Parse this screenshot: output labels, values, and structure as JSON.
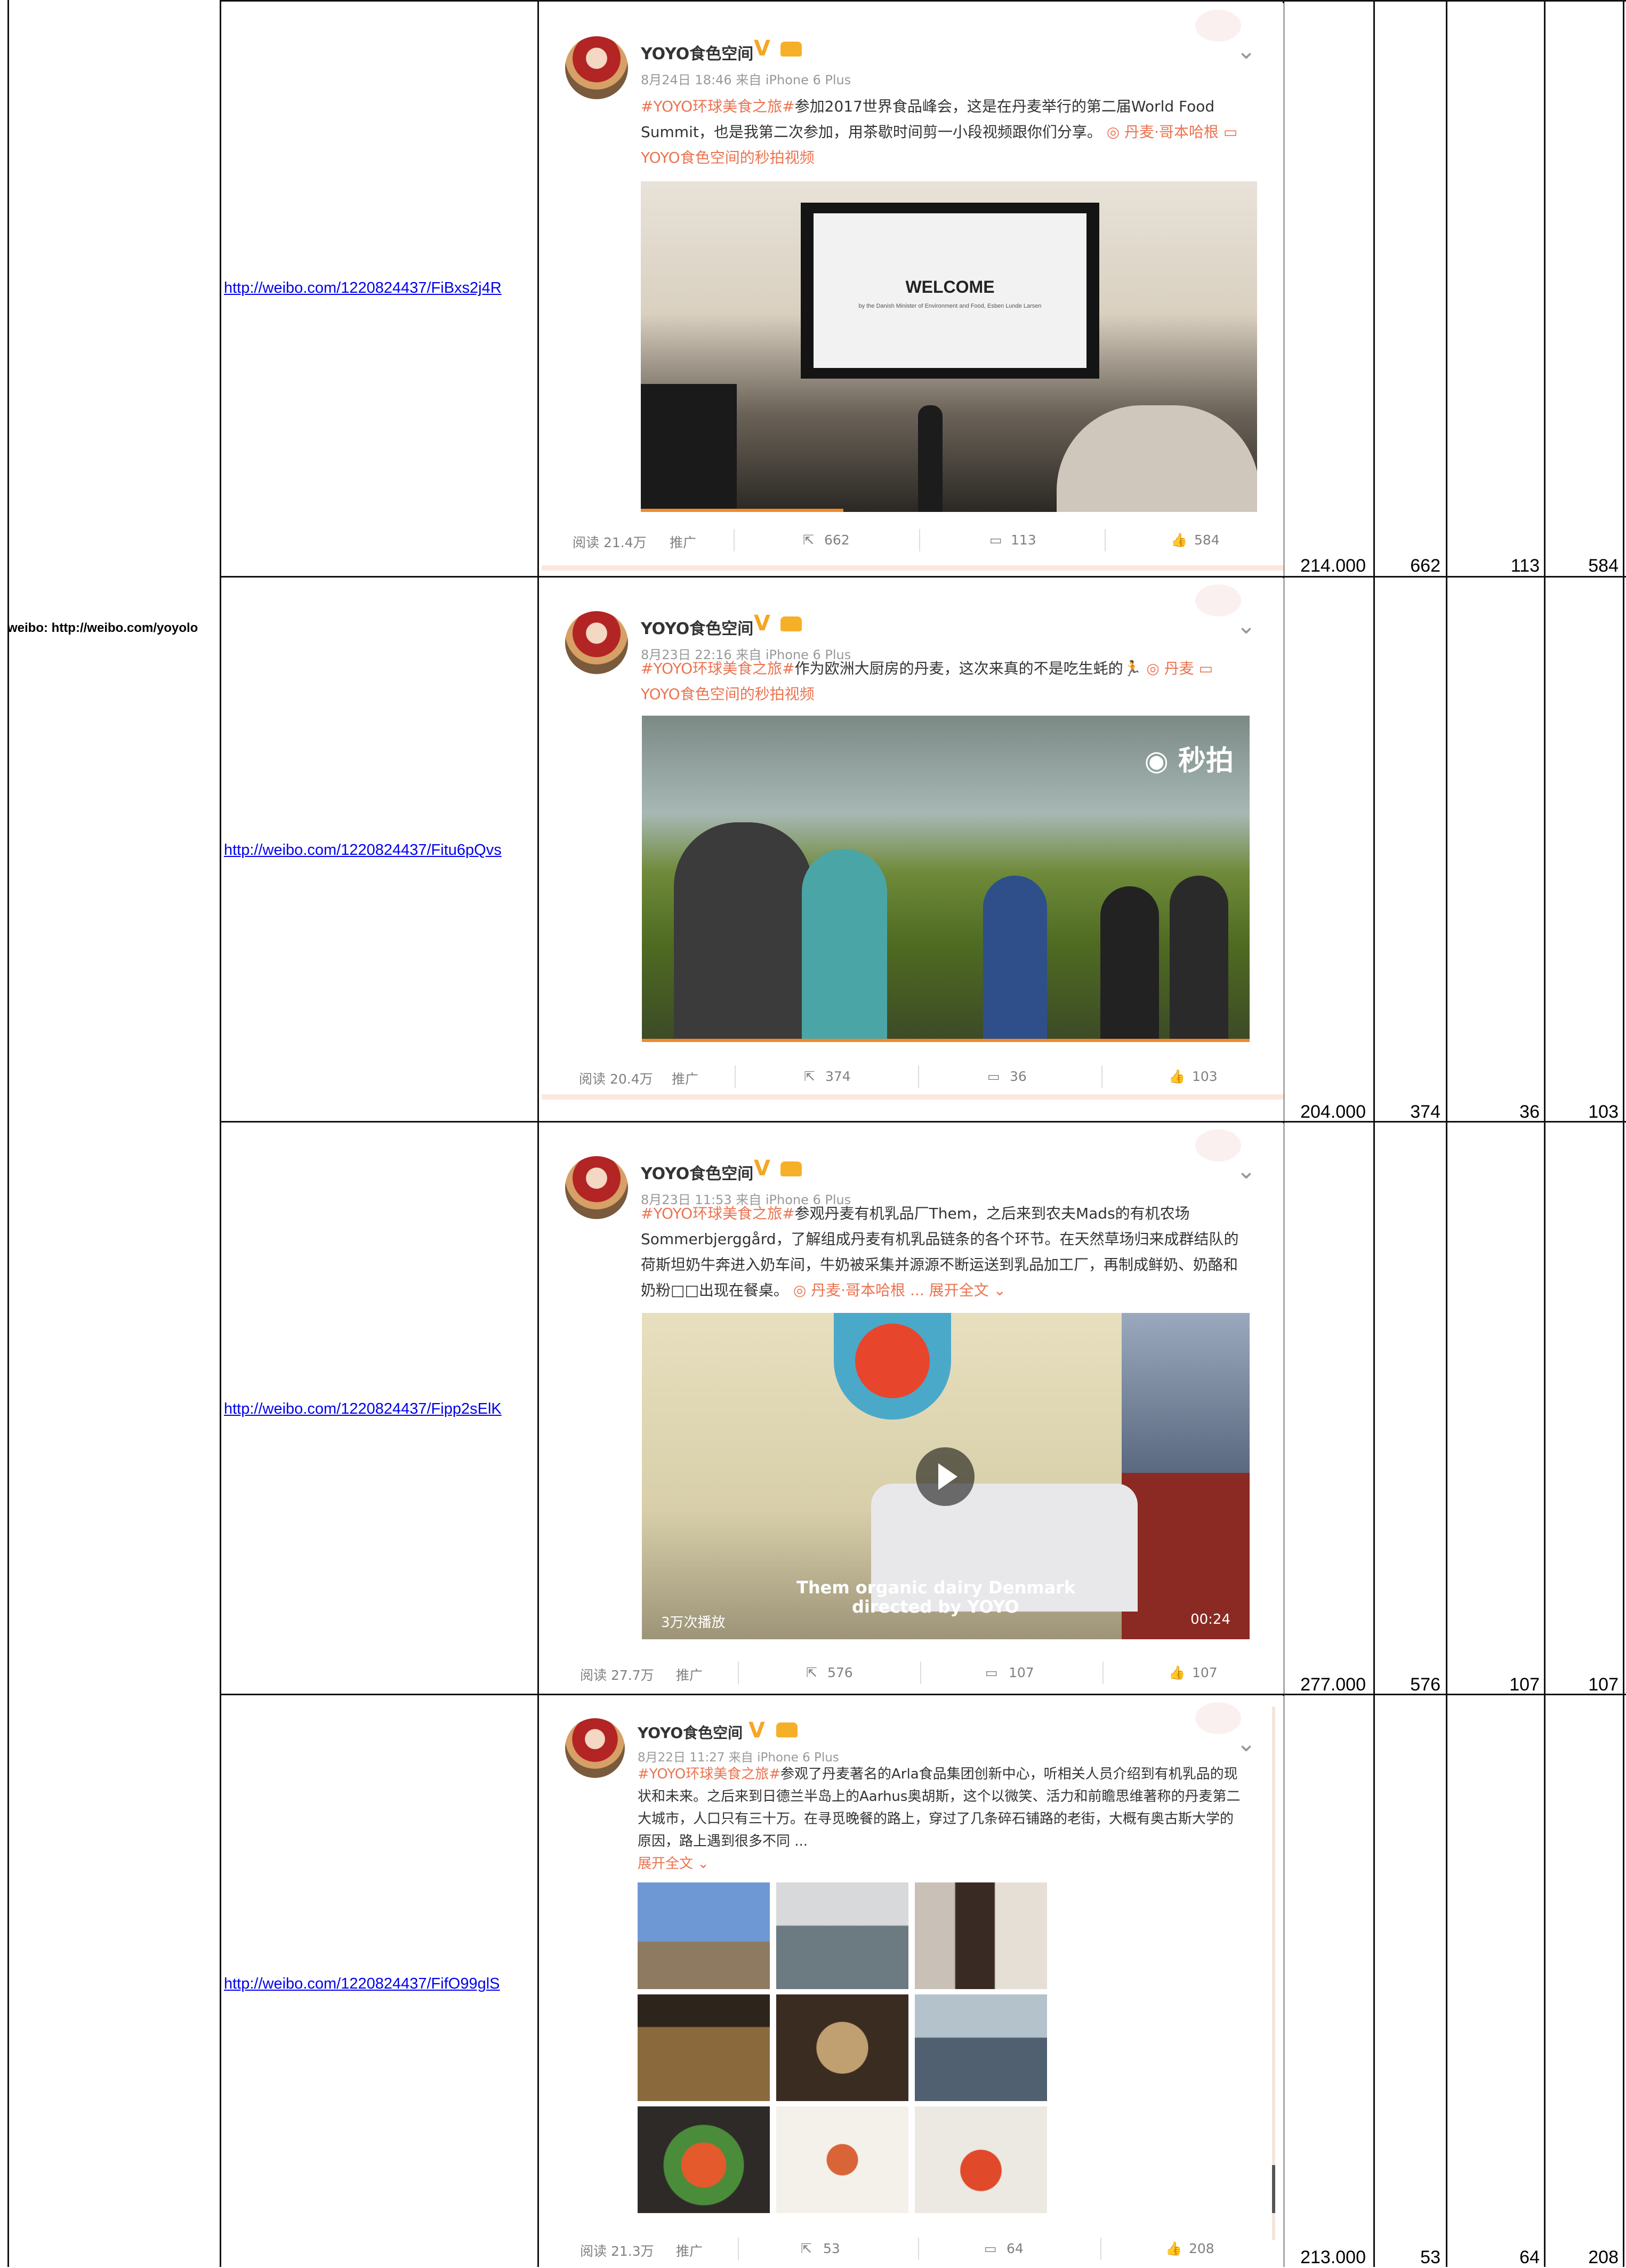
{
  "account": "weibo: http://weibo.com/yoyolo",
  "rows": [
    {
      "url": "http://weibo.com/1220824437/FiBxs2j4R",
      "reads": "214.000",
      "shares": "662",
      "comments": "113",
      "likes": "584",
      "post": {
        "username": "YOYO食色空间",
        "meta": "8月24日 18:46 来自 iPhone 6 Plus",
        "hashtag": "#YOYO环球美食之旅#",
        "text": "参加2017世界食品峰会，这是在丹麦举行的第二届World Food Summit，也是我第二次参加，用茶歇时间剪一小段视频跟你们分享。",
        "location": "丹麦·哥本哈根",
        "video_label": "YOYO食色空间的秒拍视频",
        "screen_title": "WELCOME",
        "screen_sub": "by the Danish Minister of Environment and Food, Esben Lunde Larsen",
        "stats": {
          "read": "阅读 21.4万",
          "promo": "推广",
          "share": "662",
          "comment": "113",
          "like": "584"
        }
      }
    },
    {
      "url": "http://weibo.com/1220824437/Fitu6pQvs",
      "reads": "204.000",
      "shares": "374",
      "comments": "36",
      "likes": "103",
      "post": {
        "username": "YOYO食色空间",
        "meta": "8月23日 22:16 来自 iPhone 6 Plus",
        "hashtag": "#YOYO环球美食之旅#",
        "text": "作为欧洲大厨房的丹麦，这次来真的不是吃生蚝的🏃",
        "location": "丹麦",
        "video_label": "YOYO食色空间的秒拍视频",
        "watermark": "秒拍",
        "stats": {
          "read": "阅读 20.4万",
          "promo": "推广",
          "share": "374",
          "comment": "36",
          "like": "103"
        }
      }
    },
    {
      "url": "http://weibo.com/1220824437/Fipp2sElK",
      "reads": "277.000",
      "shares": "576",
      "comments": "107",
      "likes": "107",
      "post": {
        "username": "YOYO食色空间",
        "meta": "8月23日 11:53 来自 iPhone 6 Plus",
        "hashtag": "#YOYO环球美食之旅#",
        "text": "参观丹麦有机乳品厂Them，之后来到农夫Mads的有机农场Sommerbjerggård，了解组成丹麦有机乳品链条的各个环节。在天然草场归来成群结队的荷斯坦奶牛奔进入奶车间，牛奶被采集并源源不断运送到乳品加工厂，再制成鲜奶、奶酪和奶粉□□出现在餐桌。",
        "location": "丹麦·哥本哈根",
        "expand": "... 展开全文",
        "overlay_title": "Them organic dairy Denmark",
        "overlay_sub": "directed by YOYO",
        "views": "3万次播放",
        "duration": "00:24",
        "stats": {
          "read": "阅读 27.7万",
          "promo": "推广",
          "share": "576",
          "comment": "107",
          "like": "107"
        }
      }
    },
    {
      "url": "http://weibo.com/1220824437/FifO99glS",
      "reads": "213.000",
      "shares": "53",
      "comments": "64",
      "likes": "208",
      "post": {
        "username": "YOYO食色空间",
        "meta": "8月22日 11:27 来自 iPhone 6 Plus",
        "hashtag": "#YOYO环球美食之旅#",
        "text": "参观了丹麦著名的Arla食品集团创新中心，听相关人员介绍到有机乳品的现状和未来。之后来到日德兰半岛上的Aarhus奥胡斯，这个以微笑、活力和前瞻思维著称的丹麦第二大城市，人口只有三十万。在寻觅晚餐的路上，穿过了几条碎石铺路的老街，大概有奥古斯大学的原因，路上遇到很多不同 ...",
        "expand": "展开全文",
        "stats": {
          "read": "阅读 21.3万",
          "promo": "推广",
          "share": "53",
          "comment": "64",
          "like": "208"
        }
      }
    }
  ],
  "colors": {
    "accent": "#eb7350",
    "link": "#0000ee",
    "muted": "#999999",
    "verified": "#f5a623"
  }
}
